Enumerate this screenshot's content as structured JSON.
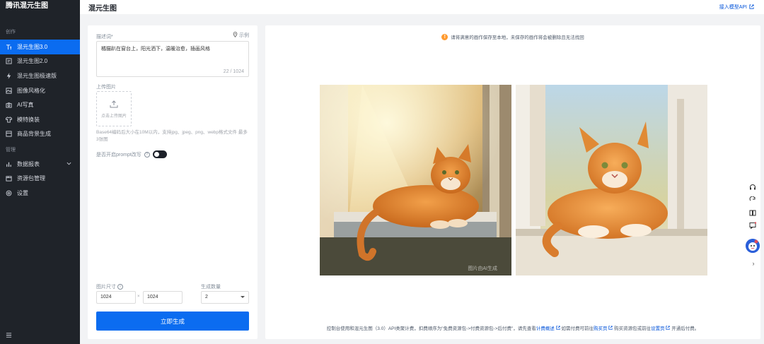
{
  "app": {
    "brand": "腾讯混元生图"
  },
  "header": {
    "title": "混元生图",
    "api_link": "接入模型API"
  },
  "sidebar": {
    "group1_label": "创作",
    "group2_label": "管理",
    "items1": [
      {
        "label": "混元生图3.0",
        "icon": "text-to-image-icon",
        "active": true
      },
      {
        "label": "混元生图2.0",
        "icon": "image-frame-icon"
      },
      {
        "label": "混元生图极速版",
        "icon": "lightning-icon"
      },
      {
        "label": "图像风格化",
        "icon": "palette-icon"
      },
      {
        "label": "AI写真",
        "icon": "camera-icon"
      },
      {
        "label": "模特换装",
        "icon": "shirt-icon"
      },
      {
        "label": "商品背景生成",
        "icon": "box-icon"
      }
    ],
    "items2": [
      {
        "label": "数据报表",
        "icon": "chart-icon"
      },
      {
        "label": "资源包管理",
        "icon": "package-icon"
      },
      {
        "label": "设置",
        "icon": "gear-icon"
      }
    ]
  },
  "form": {
    "prompt_label": "描述词*",
    "example_label": "示例",
    "prompt_value": "橘猫趴在窗台上，阳光洒下，温暖治愈，插画风格",
    "counter": "22 / 1024",
    "upload_label": "上传图片",
    "upload_button": "点击上传图片",
    "upload_hint": "Base64编码后大小在10M以内，支持jpg、jpeg、png、webp格式文件 最多3张图",
    "prompt_rewrite_label": "是否开启prompt改写",
    "size_label": "图片尺寸",
    "width": "1024",
    "height": "1024",
    "times_sign": "×",
    "count_label": "生成数量",
    "count": "2",
    "generate_button": "立即生成"
  },
  "result": {
    "warning": "请将满意的画作保存至本地，未保存的画作将会被删除且无法找回",
    "watermark": "图片由AI生成",
    "footer": {
      "part1": "控制台使用和混元生图（3.0）API类聚计费，扣费顺序为\"免费资源包->付费资源包->后付费\"，请先查看",
      "link1": "计费概述",
      "part2": "如需付费可前往",
      "link2": "购买页",
      "part3": "购买资源包或前往",
      "link3": "设置页",
      "part4": "开通后付费。"
    }
  },
  "colors": {
    "accent": "#0b6cf0",
    "sidebar_bg": "#1f2329",
    "warn": "#ff9a2e"
  }
}
